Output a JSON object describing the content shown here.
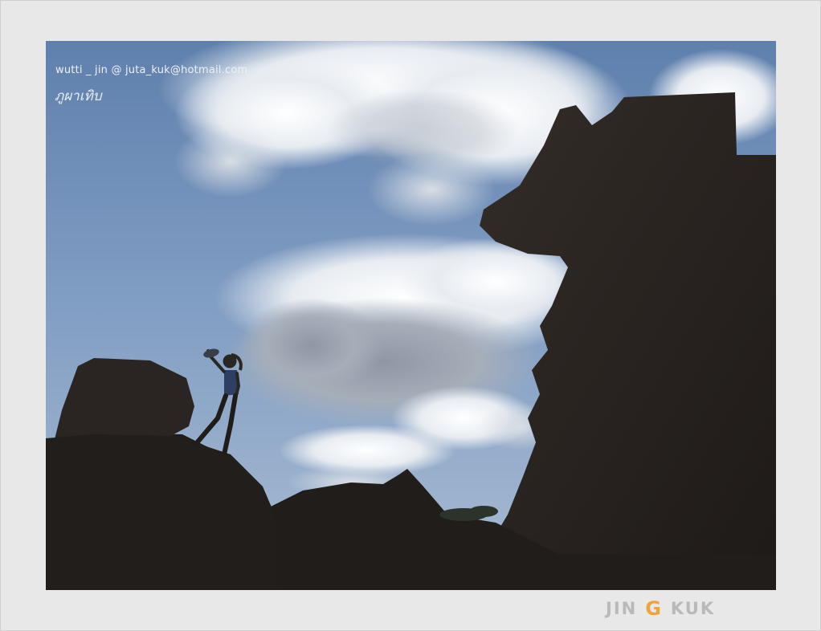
{
  "watermark": {
    "credit": "wutti _ jin @  juta_kuk@hotmail.com",
    "place": "ภูผาเทิบ"
  },
  "signature": {
    "part1": "JIN",
    "mark": "G",
    "part2": "KUK",
    "accent_color": "#f2a23a"
  },
  "colors": {
    "frame": "#e8e8e8",
    "sky": "#6e8fb8",
    "rock": "#262220"
  }
}
